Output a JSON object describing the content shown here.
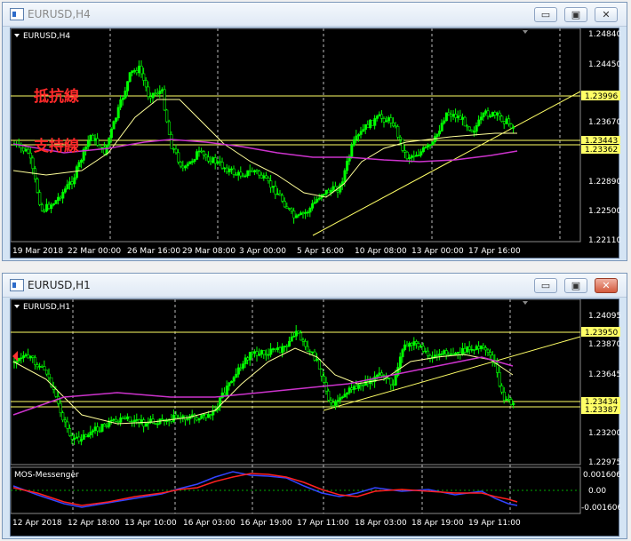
{
  "top_window": {
    "title": "EURUSD,H4",
    "symbol_label": "EURUSD,H4",
    "annotations": [
      "抵抗線",
      "支持線"
    ],
    "price_ticks": [
      "1.24840",
      "1.24450",
      "1.23670",
      "1.23280",
      "1.22890",
      "1.22500",
      "1.22110"
    ],
    "price_tags": [
      "1.23996",
      "1.23443",
      "1.23362"
    ],
    "time_ticks": [
      "19 Mar 2018",
      "22 Mar 00:00",
      "26 Mar 16:00",
      "29 Mar 08:00",
      "3 Apr 00:00",
      "5 Apr 16:00",
      "10 Apr 08:00",
      "13 Apr 00:00",
      "17 Apr 16:00"
    ],
    "buttons": {
      "minimize": "▭",
      "restore": "▣",
      "close": "✕"
    }
  },
  "bottom_window": {
    "title": "EURUSD,H1",
    "symbol_label": "EURUSD,H1",
    "indicator_label": "MOS-Messenger",
    "price_ticks": [
      "1.24095",
      "1.23870",
      "1.23645",
      "1.23200",
      "1.22975"
    ],
    "price_tags": [
      "1.23950",
      "1.23434",
      "1.23387"
    ],
    "indicator_ticks": [
      "0.001606",
      "0.00",
      "-0.001606"
    ],
    "time_ticks": [
      "12 Apr 2018",
      "12 Apr 18:00",
      "13 Apr 10:00",
      "16 Apr 03:00",
      "16 Apr 19:00",
      "17 Apr 11:00",
      "18 Apr 03:00",
      "18 Apr 19:00",
      "19 Apr 11:00"
    ],
    "buttons": {
      "minimize": "▭",
      "restore": "▣",
      "close": "✕"
    }
  },
  "colors": {
    "background": "#000000",
    "bull_candle": "#00ff00",
    "level_line": "#ffff66",
    "ma_fast": "#ffff99",
    "ma_slow": "#cc33cc",
    "indicator_red": "#ff2020",
    "indicator_blue": "#3344ff",
    "annotation": "#ff2a2a"
  }
}
